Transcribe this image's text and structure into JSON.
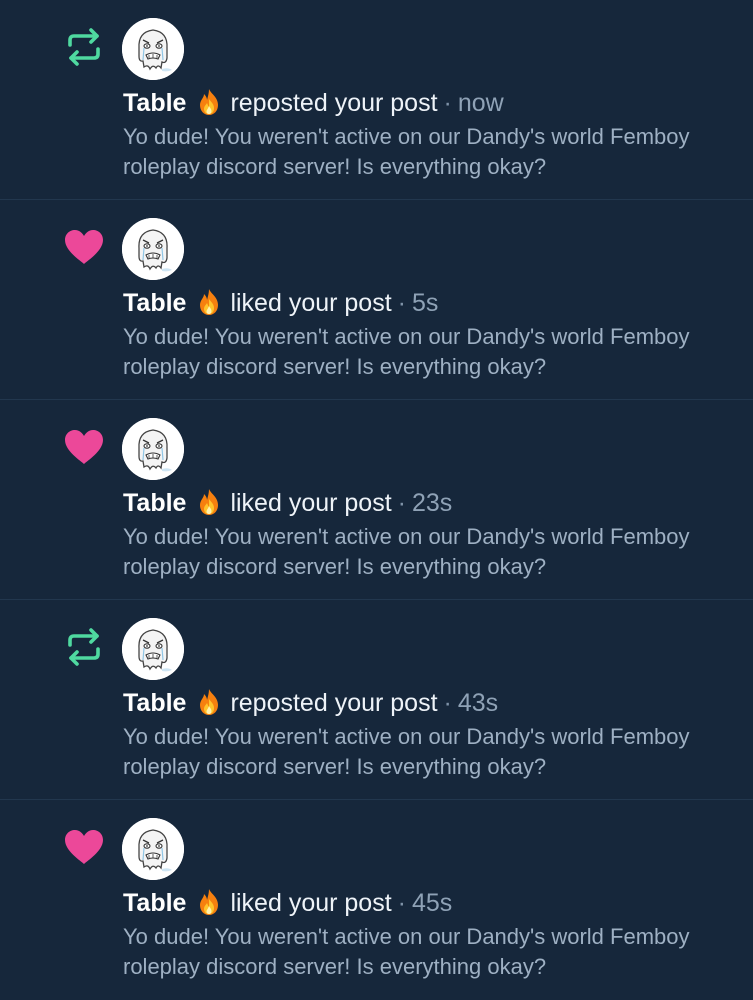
{
  "colors": {
    "background": "#16273b",
    "divider": "#22374e",
    "repost_icon": "#4fd9a0",
    "like_icon": "#ec4899",
    "primary_text": "#eef3f8",
    "secondary_text": "#9eb0c3"
  },
  "notifications": [
    {
      "type": "repost",
      "icon": "repost-icon",
      "author": "Table",
      "author_emoji": "fire-emoji",
      "action": "reposted your post",
      "separator": "·",
      "time": "now",
      "post_text": "Yo dude! You weren't active on our Dandy's world Femboy roleplay discord server! Is everything okay?"
    },
    {
      "type": "like",
      "icon": "heart-icon",
      "author": "Table",
      "author_emoji": "fire-emoji",
      "action": "liked your post",
      "separator": "·",
      "time": "5s",
      "post_text": "Yo dude! You weren't active on our Dandy's world Femboy roleplay discord server! Is everything okay?"
    },
    {
      "type": "like",
      "icon": "heart-icon",
      "author": "Table",
      "author_emoji": "fire-emoji",
      "action": "liked your post",
      "separator": "·",
      "time": "23s",
      "post_text": "Yo dude! You weren't active on our Dandy's world Femboy roleplay discord server! Is everything okay?"
    },
    {
      "type": "repost",
      "icon": "repost-icon",
      "author": "Table",
      "author_emoji": "fire-emoji",
      "action": "reposted your post",
      "separator": "·",
      "time": "43s",
      "post_text": "Yo dude! You weren't active on our Dandy's world Femboy roleplay discord server! Is everything okay?"
    },
    {
      "type": "like",
      "icon": "heart-icon",
      "author": "Table",
      "author_emoji": "fire-emoji",
      "action": "liked your post",
      "separator": "·",
      "time": "45s",
      "post_text": "Yo dude! You weren't active on our Dandy's world Femboy roleplay discord server! Is everything okay?"
    }
  ]
}
